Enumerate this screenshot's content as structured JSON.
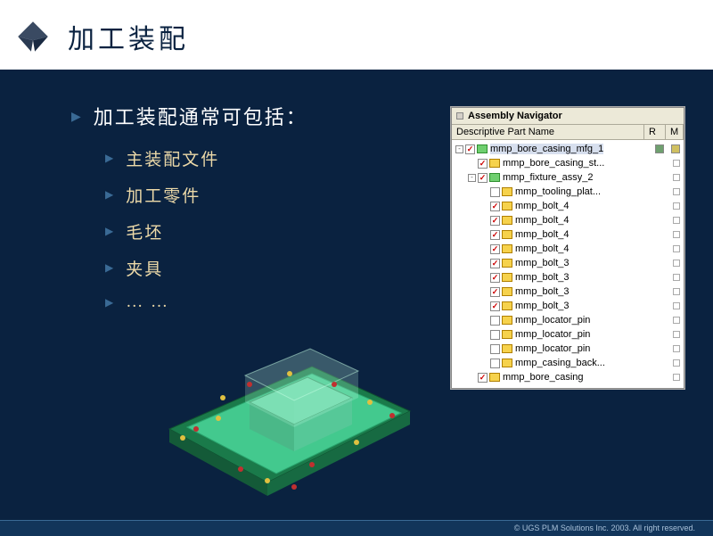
{
  "header": {
    "title": "加工装配"
  },
  "main": {
    "heading": "加工装配通常可包括：",
    "bullets": [
      "主装配文件",
      "加工零件",
      "毛坯",
      "夹具",
      "… …"
    ]
  },
  "navigator": {
    "title": "Assembly Navigator",
    "col_desc": "Descriptive Part Name",
    "col_r": "R",
    "col_m": "M",
    "tree": [
      {
        "indent": 0,
        "expander": "-",
        "checked": true,
        "icon": "green",
        "label": "mmp_bore_casing_mfg_1",
        "highlight": true,
        "rm": "both"
      },
      {
        "indent": 1,
        "expander": "",
        "checked": true,
        "icon": "y",
        "label": "mmp_bore_casing_st...",
        "rm": "sq"
      },
      {
        "indent": 1,
        "expander": "-",
        "checked": true,
        "icon": "green",
        "label": "mmp_fixture_assy_2",
        "rm": "sq"
      },
      {
        "indent": 2,
        "expander": "",
        "checked": false,
        "icon": "y",
        "label": "mmp_tooling_plat...",
        "rm": "sq"
      },
      {
        "indent": 2,
        "expander": "",
        "checked": true,
        "icon": "y",
        "label": "mmp_bolt_4",
        "rm": "sq"
      },
      {
        "indent": 2,
        "expander": "",
        "checked": true,
        "icon": "y",
        "label": "mmp_bolt_4",
        "rm": "sq"
      },
      {
        "indent": 2,
        "expander": "",
        "checked": true,
        "icon": "y",
        "label": "mmp_bolt_4",
        "rm": "sq"
      },
      {
        "indent": 2,
        "expander": "",
        "checked": true,
        "icon": "y",
        "label": "mmp_bolt_4",
        "rm": "sq"
      },
      {
        "indent": 2,
        "expander": "",
        "checked": true,
        "icon": "y",
        "label": "mmp_bolt_3",
        "rm": "sq"
      },
      {
        "indent": 2,
        "expander": "",
        "checked": true,
        "icon": "y",
        "label": "mmp_bolt_3",
        "rm": "sq"
      },
      {
        "indent": 2,
        "expander": "",
        "checked": true,
        "icon": "y",
        "label": "mmp_bolt_3",
        "rm": "sq"
      },
      {
        "indent": 2,
        "expander": "",
        "checked": true,
        "icon": "y",
        "label": "mmp_bolt_3",
        "rm": "sq"
      },
      {
        "indent": 2,
        "expander": "",
        "checked": false,
        "icon": "y",
        "label": "mmp_locator_pin",
        "rm": "sq"
      },
      {
        "indent": 2,
        "expander": "",
        "checked": false,
        "icon": "y",
        "label": "mmp_locator_pin",
        "rm": "sq"
      },
      {
        "indent": 2,
        "expander": "",
        "checked": false,
        "icon": "y",
        "label": "mmp_locator_pin",
        "rm": "sq"
      },
      {
        "indent": 2,
        "expander": "",
        "checked": false,
        "icon": "y",
        "label": "mmp_casing_back...",
        "rm": "sq"
      },
      {
        "indent": 1,
        "expander": "",
        "checked": true,
        "icon": "y",
        "label": "mmp_bore_casing",
        "rm": "sq"
      }
    ]
  },
  "footer": {
    "copyright": "© UGS PLM Solutions Inc. 2003. All right reserved."
  }
}
